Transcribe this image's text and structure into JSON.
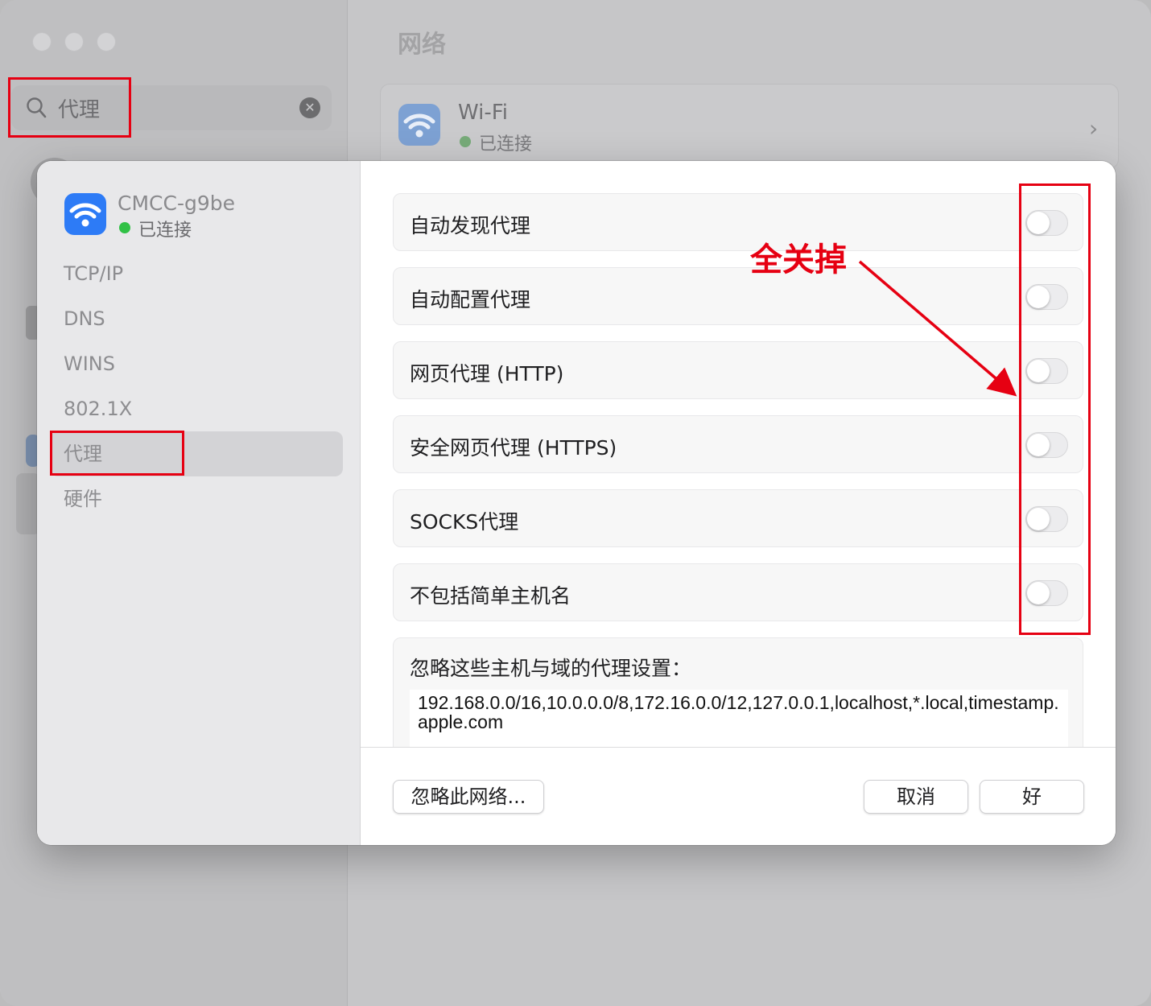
{
  "window": {
    "title": "网络",
    "search": {
      "value": "代理"
    },
    "wifi_card": {
      "name": "Wi-Fi",
      "status": "已连接"
    }
  },
  "dialog": {
    "network": {
      "name": "CMCC-g9be",
      "status": "已连接"
    },
    "nav": [
      {
        "label": "TCP/IP"
      },
      {
        "label": "DNS"
      },
      {
        "label": "WINS"
      },
      {
        "label": "802.1X"
      },
      {
        "label": "代理",
        "selected": true
      },
      {
        "label": "硬件"
      }
    ],
    "proxies": [
      {
        "label": "自动发现代理",
        "enabled": false
      },
      {
        "label": "自动配置代理",
        "enabled": false
      },
      {
        "label": "网页代理 (HTTP)",
        "enabled": false
      },
      {
        "label": "安全网页代理 (HTTPS)",
        "enabled": false
      },
      {
        "label": "SOCKS代理",
        "enabled": false
      },
      {
        "label": "不包括简单主机名",
        "enabled": false
      }
    ],
    "bypass": {
      "label": "忽略这些主机与域的代理设置：",
      "value": "192.168.0.0/16,10.0.0.0/8,172.16.0.0/12,127.0.0.1,localhost,*.local,timestamp.apple.com"
    },
    "buttons": {
      "forget": "忽略此网络...",
      "cancel": "取消",
      "ok": "好"
    }
  },
  "annotation": {
    "text": "全关掉",
    "color": "#e60012"
  },
  "colors": {
    "accent": "#2d7bf6",
    "connected": "#31c146",
    "annotation": "#e60012"
  }
}
